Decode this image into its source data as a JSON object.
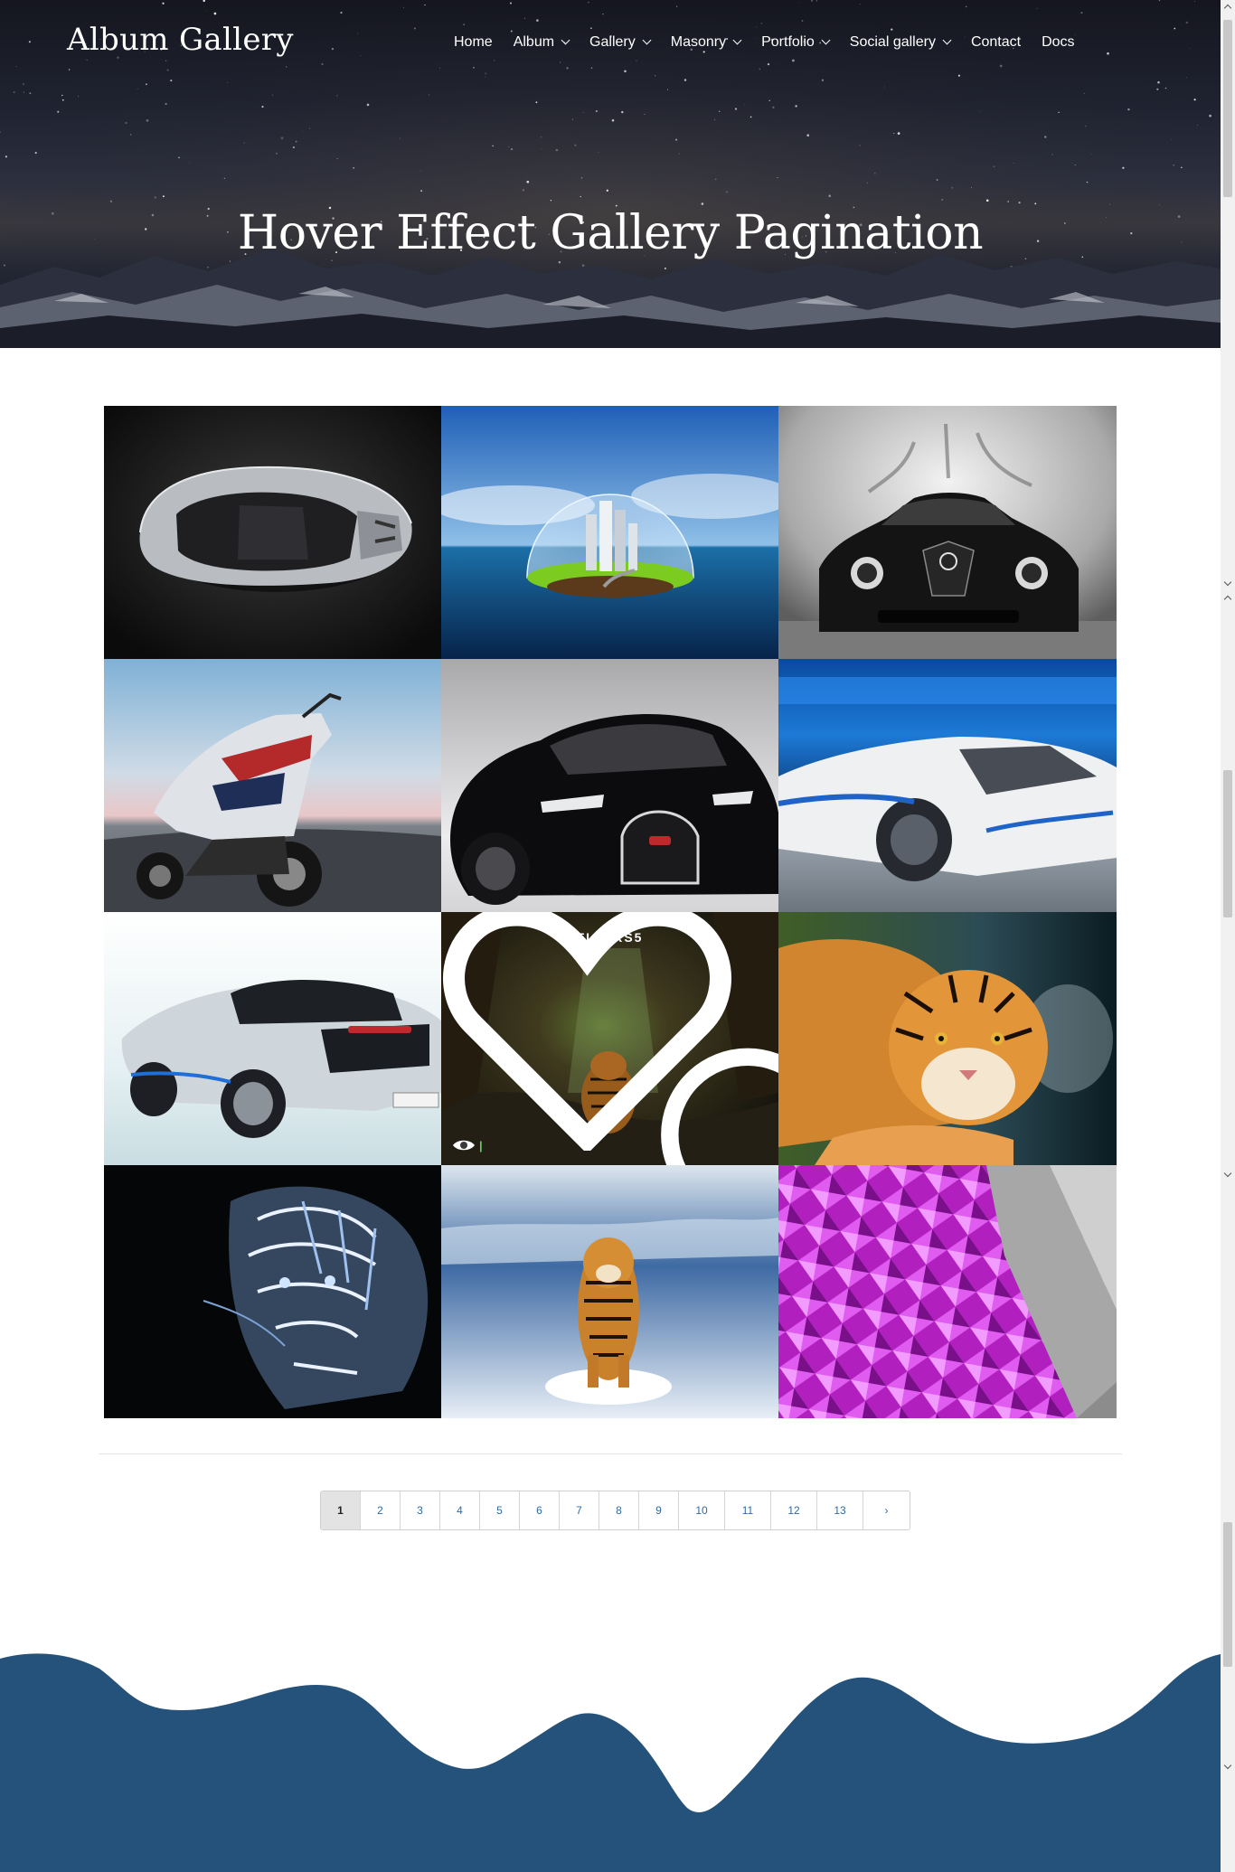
{
  "site": {
    "title": "Album Gallery"
  },
  "nav": [
    {
      "label": "Home",
      "dropdown": false
    },
    {
      "label": "Album",
      "dropdown": true
    },
    {
      "label": "Gallery",
      "dropdown": true
    },
    {
      "label": "Masonry",
      "dropdown": true
    },
    {
      "label": "Portfolio",
      "dropdown": true
    },
    {
      "label": "Social gallery",
      "dropdown": true
    },
    {
      "label": "Contact",
      "dropdown": false
    },
    {
      "label": "Docs",
      "dropdown": false
    }
  ],
  "hero": {
    "heading": "Hover Effect Gallery Pagination"
  },
  "gallery": {
    "items": [
      {
        "subject": "silver supercar top view"
      },
      {
        "subject": "island city under glass dome"
      },
      {
        "subject": "black sports car front"
      },
      {
        "subject": "sport motorcycle"
      },
      {
        "subject": "black hypercar"
      },
      {
        "subject": "white concept car"
      },
      {
        "subject": "white hybrid sports car"
      },
      {
        "subject": "tiger in cave",
        "title": "TIGERS5",
        "hovered": true
      },
      {
        "subject": "tiger lying down"
      },
      {
        "subject": "neon blue tiger"
      },
      {
        "subject": "tiger running in snow"
      },
      {
        "subject": "purple geometric wall"
      }
    ],
    "hover_icons": [
      "search-icon",
      "eye-icon",
      "heart-icon"
    ]
  },
  "pagination": {
    "pages": [
      "1",
      "2",
      "3",
      "4",
      "5",
      "6",
      "7",
      "8",
      "9",
      "10",
      "11",
      "12",
      "13"
    ],
    "next": "›",
    "current": "1"
  },
  "colors": {
    "footer_wave": "#25527a",
    "pagination_link": "#2f6aa3",
    "active_page_bg": "#e3e3e3"
  }
}
